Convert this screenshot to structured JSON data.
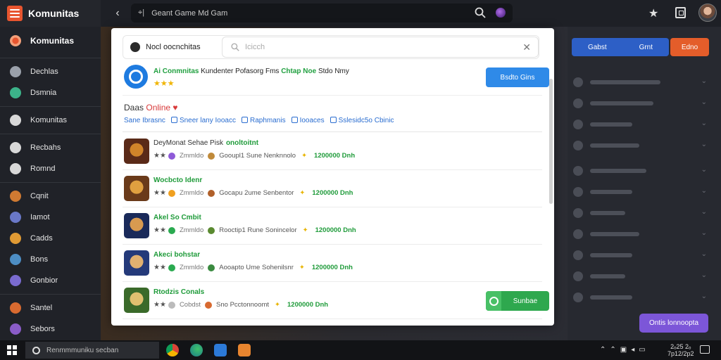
{
  "app": {
    "name": "Komunitas"
  },
  "topbar": {
    "search_text": "Geant Game Md Gam",
    "pin_glyph": "⌖|"
  },
  "sidebar": {
    "header": "Komunitas",
    "groups": [
      [
        {
          "label": "Dechlas",
          "color": "#9aa0aa"
        },
        {
          "label": "Dsmnia",
          "color": "#3cb38a"
        }
      ],
      [
        {
          "label": "Komunitas",
          "color": "#d8d8d8"
        }
      ],
      [
        {
          "label": "Recbahs",
          "color": "#d8d8d8"
        },
        {
          "label": "Romnd",
          "color": "#d8d8d8"
        }
      ],
      [
        {
          "label": "Cqnit",
          "color": "#cf7a32"
        },
        {
          "label": "Iamot",
          "color": "#6a78c8"
        },
        {
          "label": "Cadds",
          "color": "#e09a34"
        },
        {
          "label": "Bons",
          "color": "#4d8ec4"
        },
        {
          "label": "Gonbior",
          "color": "#7a6bd0"
        }
      ],
      [
        {
          "label": "Santel",
          "color": "#d86a30"
        },
        {
          "label": "Sebors",
          "color": "#8a5cc8"
        }
      ]
    ]
  },
  "card": {
    "header_title": "Nocl oocnchitas",
    "search_placeholder": "Icicch",
    "feature": {
      "prefix": "Ai Conmnitas",
      "text": "Kundenter Pofasorg Fms",
      "highlight": "Chtap Noe",
      "suffix": "Stdo Nmy",
      "stars": "★★★",
      "button": "Bsdto Gins"
    },
    "section_title": "Daas",
    "section_title_accent": "Online",
    "section_links": [
      "Sane Ibrasnc",
      "Sneer lany Iooacc",
      "Raphmanis",
      "Iooaces",
      "Sslesidc5o Cbinic"
    ],
    "rows": [
      {
        "name": "DeyMonat Sehae Pisk",
        "name_accent": "onoltoitnt",
        "sub": "Zmmldo",
        "detail": "Gooupl1 Sune Nenknnolo",
        "price": "1200000 Dnh",
        "thumb": [
          "#5a2a18",
          "#d0842a"
        ],
        "c1": "#8e5ad8",
        "c2": "#c08a3a"
      },
      {
        "name": "Wocbcto Idenr",
        "name_accent": "",
        "sub": "Zmmldo",
        "detail": "Gocapu 2ume Senbentor",
        "price": "1200000 Dnh",
        "thumb": [
          "#6a3a1a",
          "#e0a040"
        ],
        "c1": "#f0a020",
        "c2": "#b0602a"
      },
      {
        "name": "Akel So Cmbit",
        "name_accent": "",
        "sub": "Zmmldo",
        "detail": "Rooctip1 Rune Sonincelor",
        "price": "1200000 Dnh",
        "thumb": [
          "#1a2a5a",
          "#d89a50"
        ],
        "c1": "#2aaa50",
        "c2": "#5a8a30"
      },
      {
        "name": "Akeci bohstar",
        "name_accent": "",
        "sub": "Zmmldo",
        "detail": "Aooapto Ume Sohenilsnr",
        "price": "1200000 Dnh",
        "thumb": [
          "#243a7a",
          "#e0b070"
        ],
        "c1": "#2aaa50",
        "c2": "#3a8a40"
      },
      {
        "name": "Rtodzis Conals",
        "name_accent": "",
        "sub": "Cobdst",
        "detail": "Sno Pcctonnoomt",
        "price": "1200000 Dnh",
        "thumb": [
          "#3a6a2a",
          "#e0c070"
        ],
        "c1": "#bbbbbb",
        "c2": "#d86a30",
        "button": "Sunbae"
      }
    ]
  },
  "right_panel": {
    "blue_label": "Gabst",
    "blue_label_2": "Grnt",
    "orange_label": "Edno",
    "online_button": "Ontis lonnoopta"
  },
  "taskbar": {
    "search_text": "Renmmmuniku secban",
    "clock_time": "2ₒ25 2ₒ",
    "clock_date": "7p12/2p2"
  },
  "colors": {
    "accent_blue": "#2f8ae8",
    "accent_green": "#1f9b3a",
    "accent_orange": "#e8552f",
    "accent_purple": "#7c56d8"
  }
}
